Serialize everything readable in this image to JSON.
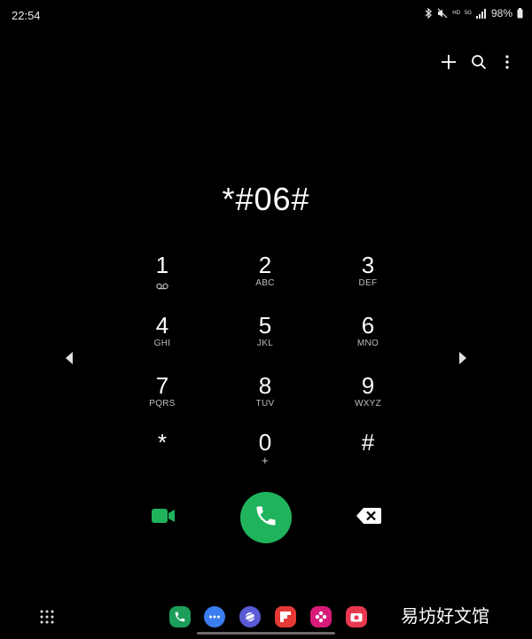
{
  "status_bar": {
    "time": "22:54",
    "network_label": "5G",
    "hd_label": "HD",
    "battery_percent": "98%"
  },
  "dialer": {
    "display_number": "*#06#",
    "keys": [
      {
        "digit": "1",
        "letters": ""
      },
      {
        "digit": "2",
        "letters": "ABC"
      },
      {
        "digit": "3",
        "letters": "DEF"
      },
      {
        "digit": "4",
        "letters": "GHI"
      },
      {
        "digit": "5",
        "letters": "JKL"
      },
      {
        "digit": "6",
        "letters": "MNO"
      },
      {
        "digit": "7",
        "letters": "PQRS"
      },
      {
        "digit": "8",
        "letters": "TUV"
      },
      {
        "digit": "9",
        "letters": "WXYZ"
      },
      {
        "digit": "*",
        "letters": ""
      },
      {
        "digit": "0",
        "letters": "+"
      },
      {
        "digit": "#",
        "letters": ""
      }
    ]
  },
  "icons": {
    "add": "plus-icon",
    "search": "search-icon",
    "more": "more-vertical-icon",
    "voicemail": "voicemail-icon",
    "video_call": "video-call-icon",
    "call": "phone-icon",
    "backspace": "backspace-icon",
    "left_arrow": "arrow-left-icon",
    "right_arrow": "arrow-right-icon",
    "app_drawer": "app-grid-icon"
  },
  "colors": {
    "background": "#000000",
    "call_green": "#1fb45c",
    "video_green": "#1fb45c",
    "phone_app": "#1d9e5a",
    "messages_app": "#3a7ef0",
    "internet_app": "#5b5bd6",
    "flipboard_app": "#e53935",
    "blossom_app": "#d81b79",
    "camera_app": "#e8384f"
  },
  "watermark": "易坊好文馆"
}
